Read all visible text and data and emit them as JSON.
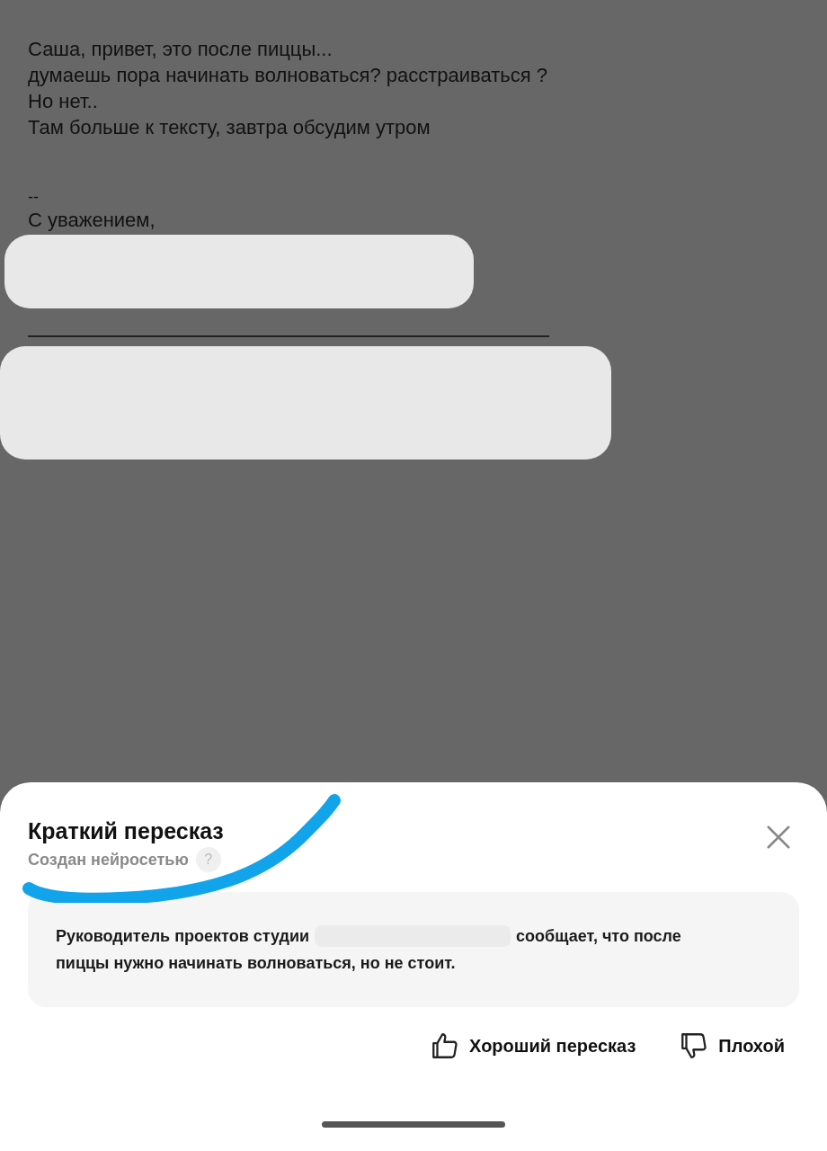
{
  "email": {
    "lines": [
      "Саша, привет, это после пиццы...",
      "думаешь пора начинать волноваться? расстраиваться ?",
      "Но нет..",
      "Там больше к тексту, завтра обсудим утром"
    ],
    "signature_separator": "--",
    "closing": "С уважением,"
  },
  "summary_sheet": {
    "title": "Краткий пересказ",
    "subtitle": "Создан нейросетью",
    "help": "?",
    "text_before": "Руководитель проектов студии",
    "text_after": [
      "сообщает, что после",
      "пиццы нужно начинать волноваться, но не стоит."
    ],
    "feedback": [
      {
        "label": "Хороший пересказ",
        "kind": "like"
      },
      {
        "label": "Плохой",
        "kind": "dislike"
      }
    ]
  }
}
